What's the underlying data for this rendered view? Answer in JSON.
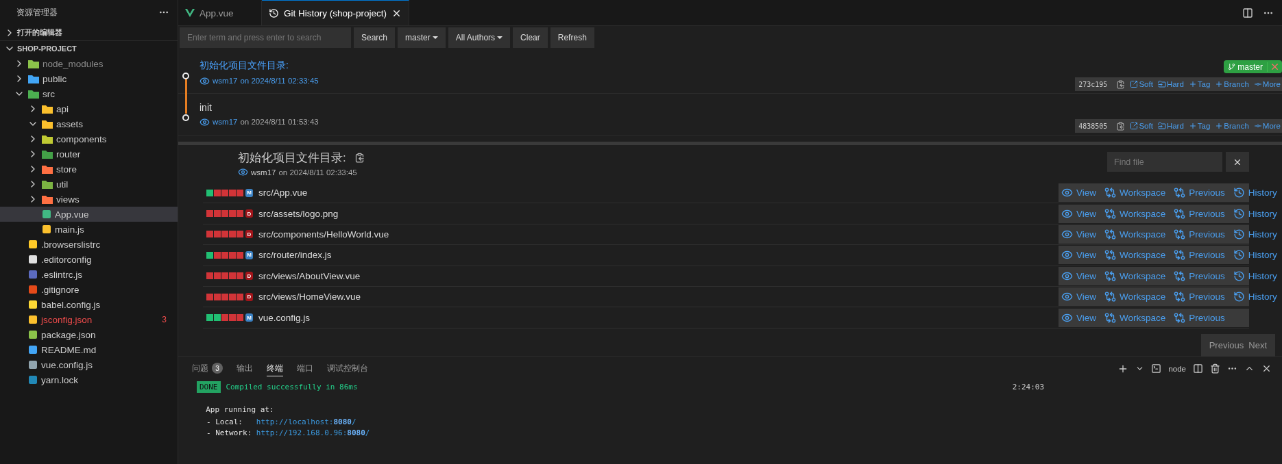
{
  "explorer": {
    "title": "资源管理器",
    "open_editors": {
      "label": "打开的编辑器",
      "expanded": false
    },
    "project": {
      "label": "SHOP-PROJECT",
      "expanded": true,
      "items": [
        {
          "name": "node_modules",
          "kind": "folder",
          "expanded": false,
          "selected": false,
          "ignored": true,
          "error": false,
          "color": "#8bc34a"
        },
        {
          "name": "public",
          "kind": "folder",
          "expanded": false,
          "selected": false,
          "ignored": false,
          "error": false,
          "color": "#42a5f5"
        },
        {
          "name": "src",
          "kind": "folder",
          "expanded": true,
          "selected": false,
          "ignored": false,
          "error": false,
          "color": "#4caf50",
          "children": [
            {
              "name": "api",
              "kind": "folder",
              "expanded": false,
              "selected": false,
              "ignored": false,
              "error": false,
              "color": "#fbc02d"
            },
            {
              "name": "assets",
              "kind": "folder",
              "expanded": true,
              "selected": false,
              "ignored": false,
              "error": false,
              "color": "#fbc02d"
            },
            {
              "name": "components",
              "kind": "folder",
              "expanded": false,
              "selected": false,
              "ignored": false,
              "error": false,
              "color": "#c0ca33"
            },
            {
              "name": "router",
              "kind": "folder",
              "expanded": false,
              "selected": false,
              "ignored": false,
              "error": false,
              "color": "#43a047"
            },
            {
              "name": "store",
              "kind": "folder",
              "expanded": false,
              "selected": false,
              "ignored": false,
              "error": false,
              "color": "#ff7043"
            },
            {
              "name": "util",
              "kind": "folder",
              "expanded": false,
              "selected": false,
              "ignored": false,
              "error": false,
              "color": "#7cb342"
            },
            {
              "name": "views",
              "kind": "folder",
              "expanded": false,
              "selected": false,
              "ignored": false,
              "error": false,
              "color": "#ff7043"
            },
            {
              "name": "App.vue",
              "kind": "file",
              "selected": true,
              "ignored": false,
              "error": false,
              "color": "#41b883"
            },
            {
              "name": "main.js",
              "kind": "file",
              "selected": false,
              "ignored": false,
              "error": false,
              "color": "#fbc02d"
            }
          ]
        },
        {
          "name": ".browserslistrc",
          "kind": "file",
          "selected": false,
          "ignored": false,
          "error": false,
          "color": "#ffca28"
        },
        {
          "name": ".editorconfig",
          "kind": "file",
          "selected": false,
          "ignored": false,
          "error": false,
          "color": "#e0e0e0"
        },
        {
          "name": ".eslintrc.js",
          "kind": "file",
          "selected": false,
          "ignored": false,
          "error": false,
          "color": "#5c6bc0"
        },
        {
          "name": ".gitignore",
          "kind": "file",
          "selected": false,
          "ignored": false,
          "error": false,
          "color": "#e64a19"
        },
        {
          "name": "babel.config.js",
          "kind": "file",
          "selected": false,
          "ignored": false,
          "error": false,
          "color": "#fdd835"
        },
        {
          "name": "jsconfig.json",
          "kind": "file",
          "selected": false,
          "ignored": false,
          "error": true,
          "color": "#fbc02d",
          "badge": "3"
        },
        {
          "name": "package.json",
          "kind": "file",
          "selected": false,
          "ignored": false,
          "error": false,
          "color": "#8bc34a"
        },
        {
          "name": "README.md",
          "kind": "file",
          "selected": false,
          "ignored": false,
          "error": false,
          "color": "#42a5f5"
        },
        {
          "name": "vue.config.js",
          "kind": "file",
          "selected": false,
          "ignored": false,
          "error": false,
          "color": "#90a4ae"
        },
        {
          "name": "yarn.lock",
          "kind": "file",
          "selected": false,
          "ignored": false,
          "error": false,
          "color": "#2188b6"
        }
      ]
    }
  },
  "tabs": [
    {
      "label": "App.vue",
      "selected": false
    },
    {
      "label": "Git History (shop-project)",
      "selected": true
    }
  ],
  "toolbar": {
    "search_placeholder": "Enter term and press enter to search",
    "buttons": [
      {
        "label": "Search",
        "dropdown": false
      },
      {
        "label": "master",
        "dropdown": true
      },
      {
        "label": "All Authors",
        "dropdown": true
      },
      {
        "label": "Clear",
        "dropdown": false
      },
      {
        "label": "Refresh",
        "dropdown": false
      }
    ]
  },
  "commits": [
    {
      "message": "初始化项目文件目录:",
      "author": "wsm17",
      "date": "on 2024/8/11 02:33:45",
      "hash": "273c195",
      "selected": true,
      "branches": [
        {
          "label": "master"
        }
      ],
      "actions": [
        {
          "label": "Soft",
          "kind": "soft"
        },
        {
          "label": "Hard",
          "kind": "hard"
        },
        {
          "label": "Tag",
          "kind": "add"
        },
        {
          "label": "Branch",
          "kind": "add"
        },
        {
          "label": "More",
          "kind": "more"
        }
      ]
    },
    {
      "message": "init",
      "author": "wsm17",
      "date": "on 2024/8/11 01:53:43",
      "hash": "4838505",
      "selected": false,
      "actions": [
        {
          "label": "Soft",
          "kind": "soft"
        },
        {
          "label": "Hard",
          "kind": "hard"
        },
        {
          "label": "Tag",
          "kind": "add"
        },
        {
          "label": "Branch",
          "kind": "add"
        },
        {
          "label": "More",
          "kind": "more"
        }
      ]
    }
  ],
  "details": {
    "title": "初始化项目文件目录:",
    "author": "wsm17",
    "date": "on 2024/8/11 02:33:45",
    "find_placeholder": "Find file",
    "files": [
      {
        "path": "src/App.vue",
        "status": "M",
        "kind": "modified",
        "blocks": [
          {
            "added": true
          },
          {
            "added": false
          },
          {
            "added": false
          },
          {
            "added": false
          },
          {
            "added": false
          }
        ],
        "actions": [
          {
            "label": "View",
            "kind": "view"
          },
          {
            "label": "Workspace",
            "kind": "compare"
          },
          {
            "label": "Previous",
            "kind": "compare"
          },
          {
            "label": "History",
            "kind": "history"
          }
        ]
      },
      {
        "path": "src/assets/logo.png",
        "status": "D",
        "kind": "deleted",
        "blocks": [
          {
            "added": false
          },
          {
            "added": false
          },
          {
            "added": false
          },
          {
            "added": false
          },
          {
            "added": false
          }
        ],
        "actions": [
          {
            "label": "View",
            "kind": "view"
          },
          {
            "label": "Workspace",
            "kind": "compare"
          },
          {
            "label": "Previous",
            "kind": "compare"
          },
          {
            "label": "History",
            "kind": "history"
          }
        ]
      },
      {
        "path": "src/components/HelloWorld.vue",
        "status": "D",
        "kind": "deleted",
        "blocks": [
          {
            "added": false
          },
          {
            "added": false
          },
          {
            "added": false
          },
          {
            "added": false
          },
          {
            "added": false
          }
        ],
        "actions": [
          {
            "label": "View",
            "kind": "view"
          },
          {
            "label": "Workspace",
            "kind": "compare"
          },
          {
            "label": "Previous",
            "kind": "compare"
          },
          {
            "label": "History",
            "kind": "history"
          }
        ]
      },
      {
        "path": "src/router/index.js",
        "status": "M",
        "kind": "modified",
        "blocks": [
          {
            "added": true
          },
          {
            "added": false
          },
          {
            "added": false
          },
          {
            "added": false
          },
          {
            "added": false
          }
        ],
        "actions": [
          {
            "label": "View",
            "kind": "view"
          },
          {
            "label": "Workspace",
            "kind": "compare"
          },
          {
            "label": "Previous",
            "kind": "compare"
          },
          {
            "label": "History",
            "kind": "history"
          }
        ]
      },
      {
        "path": "src/views/AboutView.vue",
        "status": "D",
        "kind": "deleted",
        "blocks": [
          {
            "added": false
          },
          {
            "added": false
          },
          {
            "added": false
          },
          {
            "added": false
          },
          {
            "added": false
          }
        ],
        "actions": [
          {
            "label": "View",
            "kind": "view"
          },
          {
            "label": "Workspace",
            "kind": "compare"
          },
          {
            "label": "Previous",
            "kind": "compare"
          },
          {
            "label": "History",
            "kind": "history"
          }
        ]
      },
      {
        "path": "src/views/HomeView.vue",
        "status": "D",
        "kind": "deleted",
        "blocks": [
          {
            "added": false
          },
          {
            "added": false
          },
          {
            "added": false
          },
          {
            "added": false
          },
          {
            "added": false
          }
        ],
        "actions": [
          {
            "label": "View",
            "kind": "view"
          },
          {
            "label": "Workspace",
            "kind": "compare"
          },
          {
            "label": "Previous",
            "kind": "compare"
          },
          {
            "label": "History",
            "kind": "history"
          }
        ]
      },
      {
        "path": "vue.config.js",
        "status": "M",
        "kind": "modified",
        "blocks": [
          {
            "added": true
          },
          {
            "added": true
          },
          {
            "added": false
          },
          {
            "added": false
          },
          {
            "added": false
          }
        ],
        "actions": [
          {
            "label": "View",
            "kind": "view"
          },
          {
            "label": "Workspace",
            "kind": "compare"
          },
          {
            "label": "Previous",
            "kind": "compare"
          }
        ]
      }
    ],
    "pager": {
      "previous": "Previous",
      "next": "Next"
    }
  },
  "panel": {
    "tabs": [
      {
        "label": "问题",
        "badge": "3",
        "selected": false
      },
      {
        "label": "输出",
        "selected": false
      },
      {
        "label": "终端",
        "selected": true
      },
      {
        "label": "端口",
        "selected": false
      },
      {
        "label": "调试控制台",
        "selected": false
      }
    ],
    "shell": "node",
    "terminal": {
      "badge": "DONE",
      "status": "Compiled successfully in 86ms",
      "time": "2:24:03",
      "heading": "App running at:",
      "urls": [
        {
          "label": "- Local:   ",
          "url": "http://localhost:**8080**/"
        },
        {
          "label": "- Network: ",
          "url": "http://192.168.0.96:**8080**/"
        }
      ]
    }
  }
}
